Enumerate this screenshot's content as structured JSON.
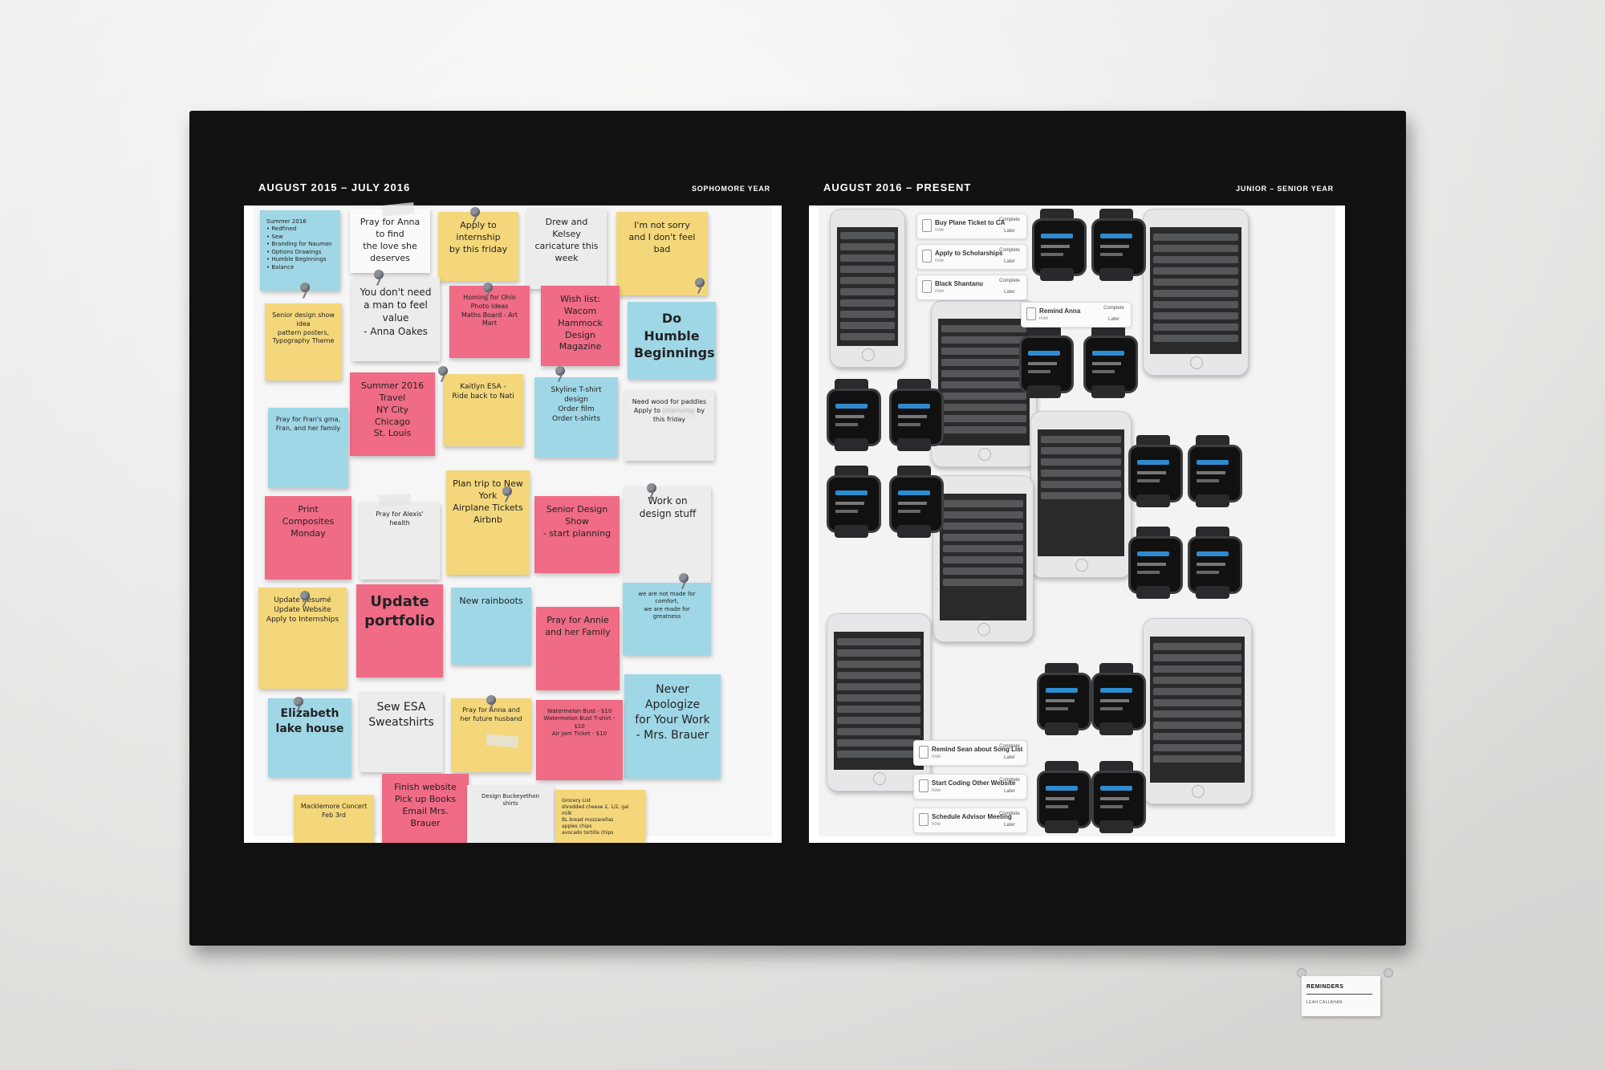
{
  "left_poster": {
    "date_range": "AUGUST 2015 – JULY 2016",
    "year_label": "SOPHOMORE YEAR",
    "notes": [
      "Summer 2016\n• Redfined\n• Sew\n• Branding for Nauman\n• Options Drawings\n• Humble Beginnings\n• Balance",
      "Pray for Anna to find\nthe love she deserves",
      "Apply to internship\nby this friday",
      "Drew and Kelsey\ncaricature this week",
      "I'm not sorry\nand I don't feel bad",
      "You don't need\na man to feel value\n- Anna Oakes",
      "Homing for Ohio\nPhoto Ideas\nMaths Board - Art Mart",
      "Wish list:\nWacom\nHammock\nDesign Magazine",
      "Do Humble\nBeginnings",
      "Senior design show idea\npattern posters,\nTypography Theme",
      "Summer 2016 Travel\nNY City\nChicago\nSt. Louis",
      "Kaitlyn ESA -\nRide back to Nati",
      "Skyline   T-shirt design\nOrder film\nOrder t-shirts",
      "Need wood for paddles\nApply to internship by this friday",
      "Pray for Fran's gma,\nFran, and her family",
      "Print Composites\nMonday",
      "Pray for Alexis' health",
      "Plan trip to New York\nAirplane Tickets\nAirbnb",
      "Senior Design Show\n- start planning",
      "Work on design stuff",
      "Update Résumé\nUpdate Website\nApply to Internships",
      "Update\nportfolio",
      "New rainboots",
      "Pray for Annie\nand her Family",
      "we are not made for comfort,\nwe are made for greatness",
      "Never Apologize\nfor Your Work\n- Mrs. Brauer",
      "Elizabeth\nlake house",
      "Sew ESA\nSweatshirts",
      "Pray for Anna and\nher future husband",
      "Watermelon Bust - $10\nWatermelon Bust T-shirt - $10\nAir Jam Ticket - $10",
      "Macklemore Concert\nFeb 3rd",
      "Finish website\nPick up Books\nEmail Mrs. Brauer",
      "Design Buckeyethon shirts",
      "Grocery List\nshredded cheese   2, 1/2, gal milk\nBL bread   mozzarellas\napples   chips\navocado   tortilla chips"
    ]
  },
  "right_poster": {
    "date_range": "AUGUST 2016 – PRESENT",
    "year_label": "JUNIOR – SENIOR YEAR",
    "banners": [
      {
        "title": "Buy Plane Ticket to CA",
        "sub": "now",
        "action1": "Complete",
        "action2": "Later"
      },
      {
        "title": "Apply to Scholarships",
        "sub": "now",
        "action1": "Complete",
        "action2": "Later"
      },
      {
        "title": "Black Shantanu",
        "sub": "now",
        "action1": "Complete",
        "action2": "Later"
      },
      {
        "title": "Remind Anna",
        "sub": "now",
        "action1": "Complete",
        "action2": "Later"
      },
      {
        "title": "Remind Sean about Song List",
        "sub": "now",
        "action1": "Complete",
        "action2": "Later"
      },
      {
        "title": "Start Coding Other Website",
        "sub": "now",
        "action1": "Complete",
        "action2": "Later"
      },
      {
        "title": "Schedule Advisor Meeting",
        "sub": "now",
        "action1": "Complete",
        "action2": "Later"
      }
    ]
  },
  "wall_label": {
    "title": "REMINDERS",
    "author": "LEAH CALLAHAN"
  },
  "colors": {
    "blue_note": "#9fd7e6",
    "yellow_note": "#f4d77a",
    "pink_note": "#ef6b86",
    "frame": "#111111"
  }
}
